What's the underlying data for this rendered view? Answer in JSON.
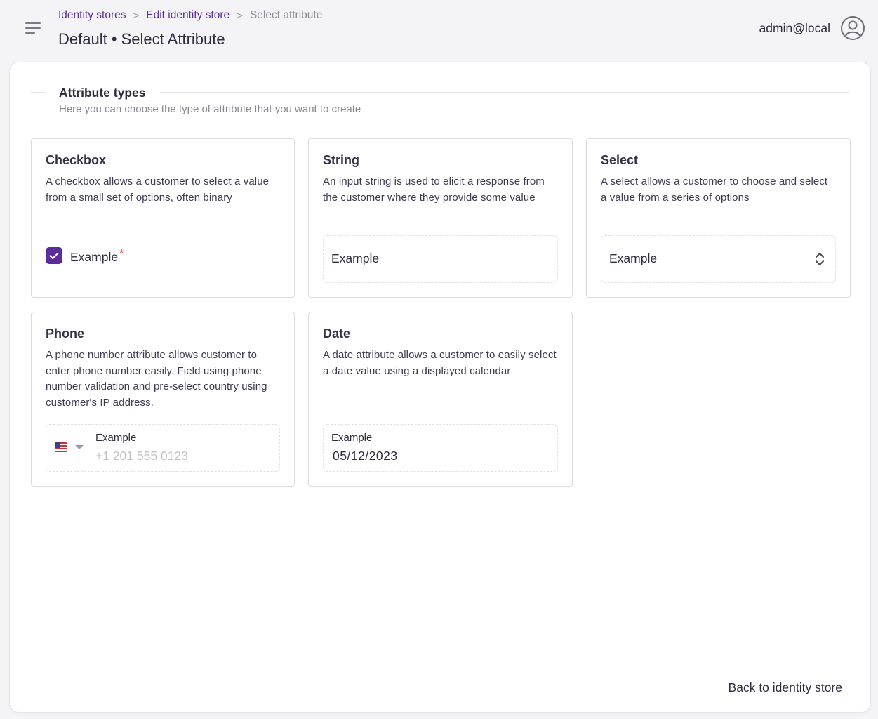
{
  "header": {
    "breadcrumb": {
      "item1": "Identity stores",
      "item2": "Edit identity store",
      "current": "Select attribute",
      "separator": ">"
    },
    "title": "Default • Select Attribute",
    "user": "admin@local"
  },
  "section": {
    "title": "Attribute types",
    "description": "Here you can choose the type of attribute that you want to create"
  },
  "cards": {
    "checkbox": {
      "title": "Checkbox",
      "description": "A checkbox allows a customer to select a value from a small set of options, often binary",
      "example_label": "Example",
      "required_mark": "*",
      "checked": true
    },
    "string": {
      "title": "String",
      "description": "An input string is used to elicit a response from the customer where they provide some value",
      "example_placeholder": "Example"
    },
    "select": {
      "title": "Select",
      "description": "A select allows a customer to choose and select a value from a series of options",
      "example_value": "Example"
    },
    "phone": {
      "title": "Phone",
      "description": "A phone number attribute allows customer to enter phone number easily. Field using phone number validation and pre-select country using customer's IP address.",
      "example_label": "Example",
      "example_placeholder": "+1 201 555 0123",
      "country_flag": "us-flag-icon"
    },
    "date": {
      "title": "Date",
      "description": "A date attribute allows a customer to easily select a date value using a displayed calendar",
      "example_label": "Example",
      "example_value": "05/12/2023"
    }
  },
  "footer": {
    "back_label": "Back to identity store"
  },
  "colors": {
    "accent": "#5b2c9a",
    "required": "#d63333",
    "background": "#f4f4f6"
  }
}
